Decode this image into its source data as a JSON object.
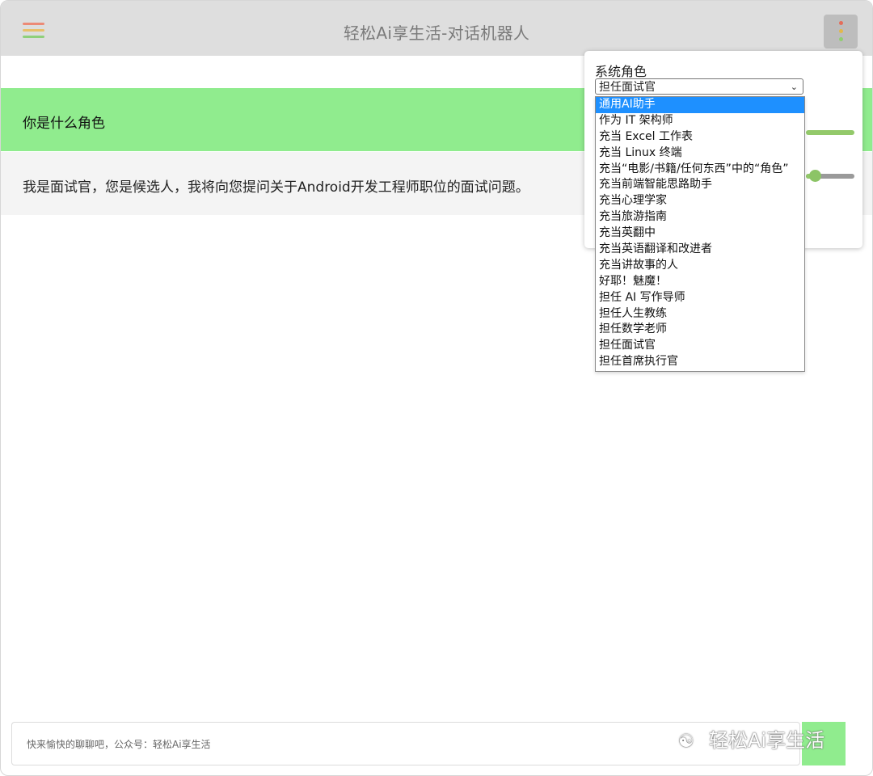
{
  "header": {
    "title": "轻松Ai享生活-对话机器人"
  },
  "messages": [
    {
      "role": "user",
      "text": "你是什么角色"
    },
    {
      "role": "assistant",
      "text": "我是面试官，您是候选人，我将向您提问关于Android开发工程师职位的面试问题。"
    }
  ],
  "settings": {
    "role_label": "系统角色",
    "selected_role": "担任面试官",
    "slider2_value": 0.1,
    "options": [
      "通用AI助手",
      "作为 IT 架构师",
      "充当 Excel 工作表",
      "充当 Linux 终端",
      "充当“电影/书籍/任何东西”中的“角色”",
      "充当前端智能思路助手",
      "充当心理学家",
      "充当旅游指南",
      "充当英翻中",
      "充当英语翻译和改进者",
      "充当讲故事的人",
      "好耶！魅魔！",
      "担任 AI 写作导师",
      "担任人生教练",
      "担任数学老师",
      "担任面试官",
      "担任首席执行官"
    ],
    "highlighted_index": 0
  },
  "composer": {
    "placeholder": "快来愉快的聊聊吧，公众号：轻松Ai享生活"
  },
  "watermark": {
    "text": "轻松Ai享生活"
  },
  "colors": {
    "user_bubble": "#90ec8e",
    "header_bg": "#dedede",
    "highlight": "#1e90ff"
  }
}
